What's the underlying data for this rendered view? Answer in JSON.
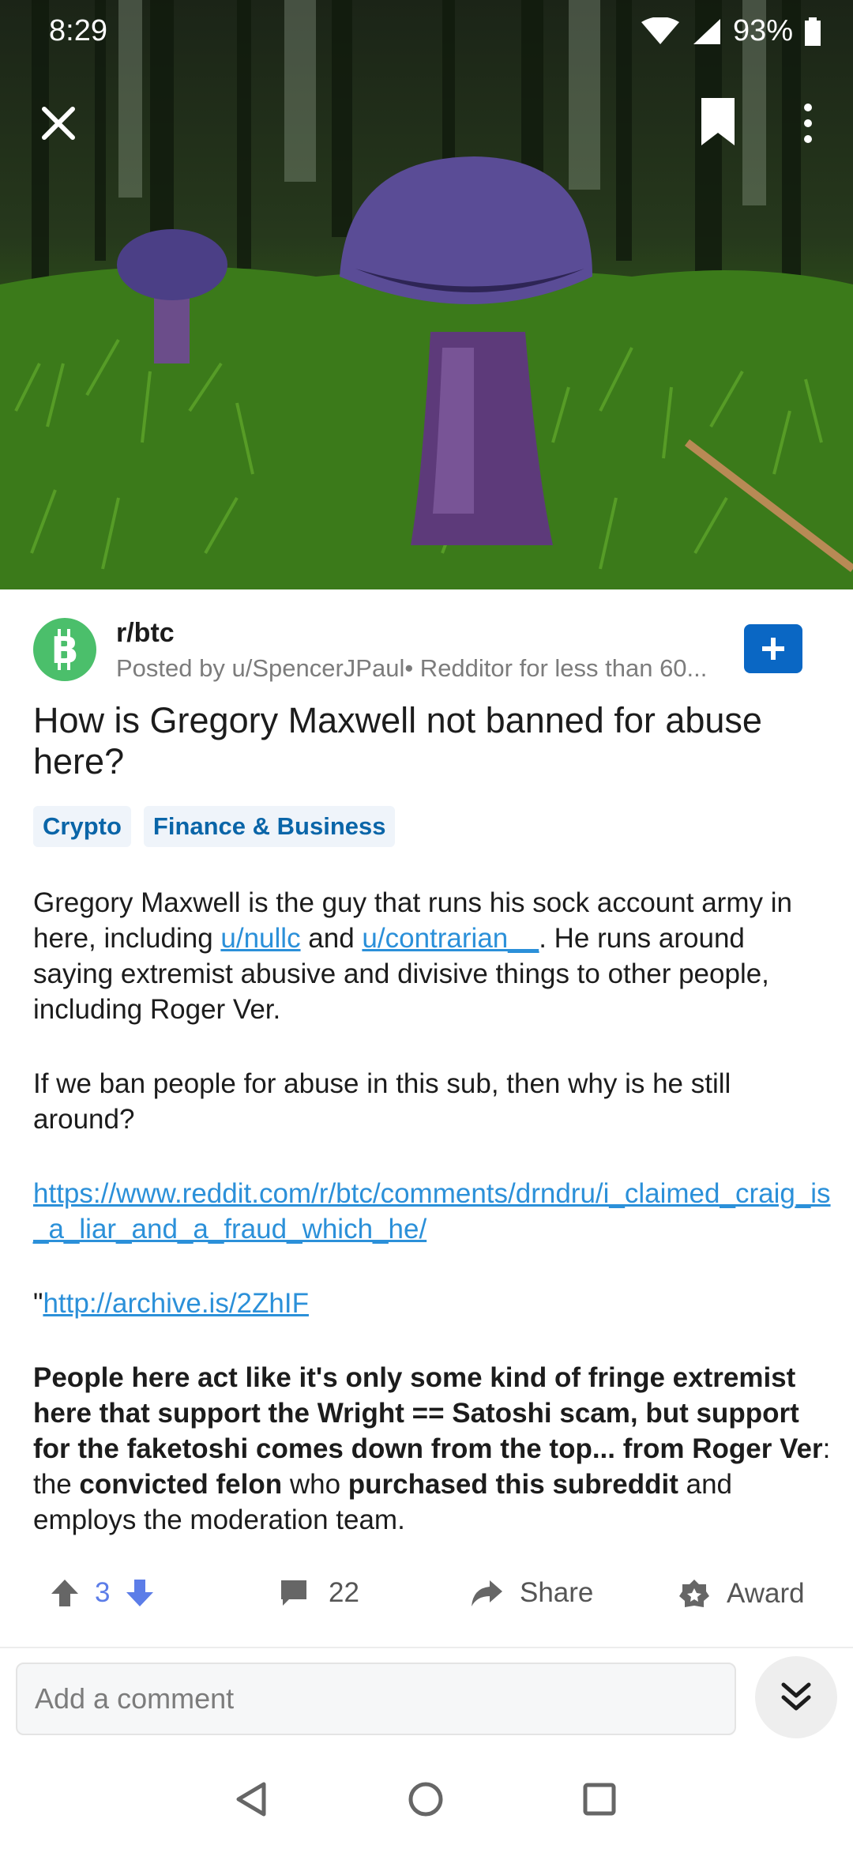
{
  "status_bar": {
    "time": "8:29",
    "battery": "93%"
  },
  "header": {
    "close_icon": "close-icon",
    "bookmark_icon": "bookmark-icon",
    "more_icon": "more-vertical-icon"
  },
  "post": {
    "subreddit": "r/btc",
    "posted_by": "Posted by u/SpencerJPaul• Redditor for less than 60...",
    "title": "How is Gregory Maxwell not banned for abuse here?",
    "flairs": [
      "Crypto",
      "Finance & Business"
    ],
    "body": {
      "p1_a": "Gregory Maxwell is the guy that runs his sock account army in here, including ",
      "p1_link1": "u/nullc",
      "p1_b": " and ",
      "p1_link2": "u/contrarian__",
      "p1_c": ". He runs around saying extremist abusive and divisive things to other people, including Roger Ver.",
      "p2": "If we ban people for abuse in this sub, then why is he still around?",
      "p3_link": "https://www.reddit.com/r/btc/comments/drndru/i_claimed_craig_is_a_liar_and_a_fraud_which_he/",
      "p4_quote": "\"",
      "p4_link": "http://archive.is/2ZhIF",
      "p5_bold1": "People here act like it's only some kind of fringe extremist here that support the Wright == Satoshi scam, but support for the faketoshi comes down from the top... from Roger Ver",
      "p5_t1": ": the ",
      "p5_bold2": "convicted felon",
      "p5_t2": " who ",
      "p5_bold3": "purchased this subreddit",
      "p5_t3": " and employs the moderation team."
    }
  },
  "actions": {
    "vote_count": "3",
    "comment_count": "22",
    "share_label": "Share",
    "award_label": "Award"
  },
  "comment_box": {
    "placeholder": "Add a comment"
  },
  "colors": {
    "accent_blue": "#0a67c4",
    "link": "#2b90d9",
    "upvote": "#5c7de8",
    "subreddit_icon": "#4bbf6b"
  }
}
